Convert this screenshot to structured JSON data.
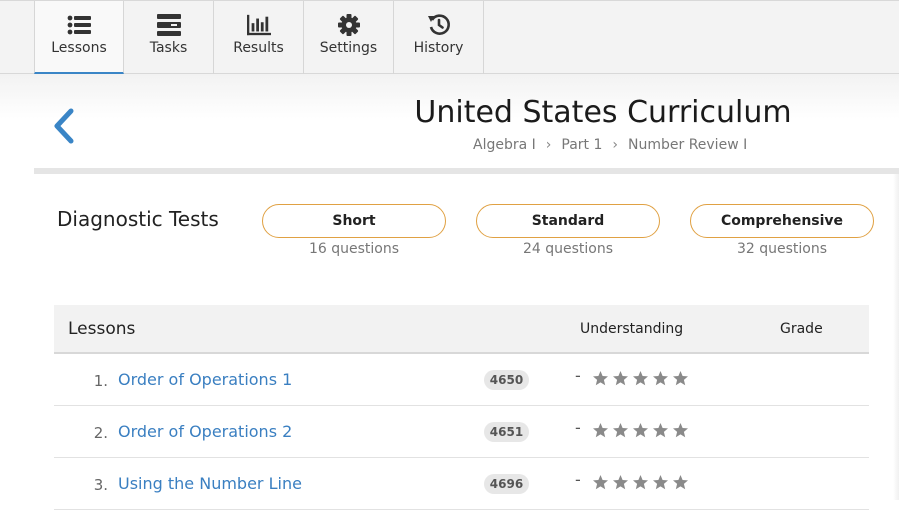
{
  "nav": {
    "tabs": [
      {
        "label": "Lessons",
        "icon": "list-icon",
        "active": true
      },
      {
        "label": "Tasks",
        "icon": "tasks-icon"
      },
      {
        "label": "Results",
        "icon": "bar-chart-icon"
      },
      {
        "label": "Settings",
        "icon": "gear-icon"
      },
      {
        "label": "History",
        "icon": "history-icon"
      }
    ]
  },
  "header": {
    "title": "United States Curriculum",
    "breadcrumb": [
      "Algebra I",
      "Part 1",
      "Number Review I"
    ],
    "back_icon": "chevron-left-icon"
  },
  "diagnostic": {
    "title": "Diagnostic Tests",
    "tests": [
      {
        "label": "Short",
        "sub": "16 questions"
      },
      {
        "label": "Standard",
        "sub": "24 questions"
      },
      {
        "label": "Comprehensive",
        "sub": "32 questions"
      }
    ]
  },
  "lessons_table": {
    "headers": {
      "lessons": "Lessons",
      "understanding": "Understanding",
      "grade": "Grade"
    },
    "rows": [
      {
        "num": "1.",
        "title": "Order of Operations 1",
        "code": "4650",
        "understanding": "-",
        "stars_filled": 0,
        "stars_total": 5
      },
      {
        "num": "2.",
        "title": "Order of Operations 2",
        "code": "4651",
        "understanding": "-",
        "stars_filled": 0,
        "stars_total": 5
      },
      {
        "num": "3.",
        "title": "Using the Number Line",
        "code": "4696",
        "understanding": "-",
        "stars_filled": 0,
        "stars_total": 5
      }
    ]
  },
  "colors": {
    "accent": "#3a85c6",
    "link": "#3a7fc1",
    "pill_border": "#e0a143",
    "star": "#8a8a8a"
  }
}
